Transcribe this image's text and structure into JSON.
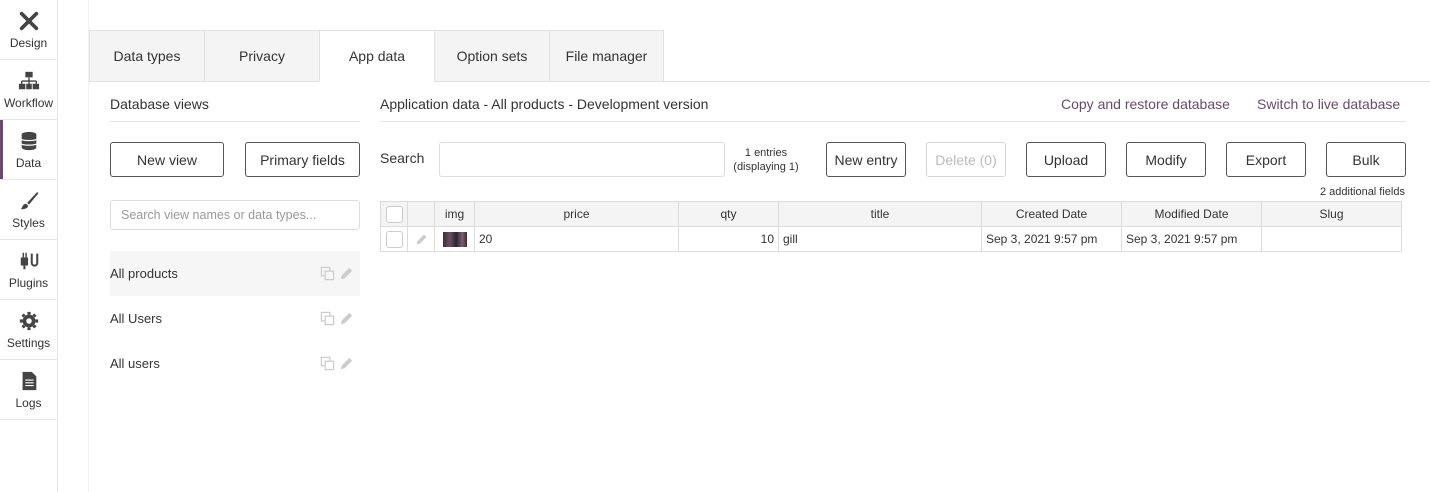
{
  "sidebar": {
    "items": [
      {
        "label": "Design",
        "icon": "design-icon"
      },
      {
        "label": "Workflow",
        "icon": "workflow-icon"
      },
      {
        "label": "Data",
        "icon": "database-icon",
        "active": true
      },
      {
        "label": "Styles",
        "icon": "brush-icon"
      },
      {
        "label": "Plugins",
        "icon": "plug-icon"
      },
      {
        "label": "Settings",
        "icon": "gear-icon"
      },
      {
        "label": "Logs",
        "icon": "document-icon"
      }
    ]
  },
  "tabs": [
    "Data types",
    "Privacy",
    "App data",
    "Option sets",
    "File manager"
  ],
  "active_tab": "App data",
  "left_panel": {
    "title": "Database views",
    "new_view_label": "New view",
    "primary_fields_label": "Primary fields",
    "search_placeholder": "Search view names or data types...",
    "views": [
      "All products",
      "All Users",
      "All users"
    ],
    "selected_view": "All products"
  },
  "right_panel": {
    "title": "Application data - All products - Development version",
    "copy_restore_label": "Copy and restore database",
    "switch_live_label": "Switch to live database",
    "search_label": "Search",
    "entries_line1": "1 entries",
    "entries_line2": "(displaying 1)",
    "buttons": {
      "new_entry": "New entry",
      "delete": "Delete (0)",
      "upload": "Upload",
      "modify": "Modify",
      "export": "Export",
      "bulk": "Bulk"
    },
    "additional_fields": "2 additional fields"
  },
  "table": {
    "columns": [
      "img",
      "price",
      "qty",
      "title",
      "Created Date",
      "Modified Date",
      "Slug"
    ],
    "rows": [
      {
        "price": "20",
        "qty": "10",
        "title": "gill",
        "created": "Sep 3, 2021 9:57 pm",
        "modified": "Sep 3, 2021 9:57 pm",
        "slug": ""
      }
    ]
  },
  "colors": {
    "accent": "#6a4a6b"
  }
}
